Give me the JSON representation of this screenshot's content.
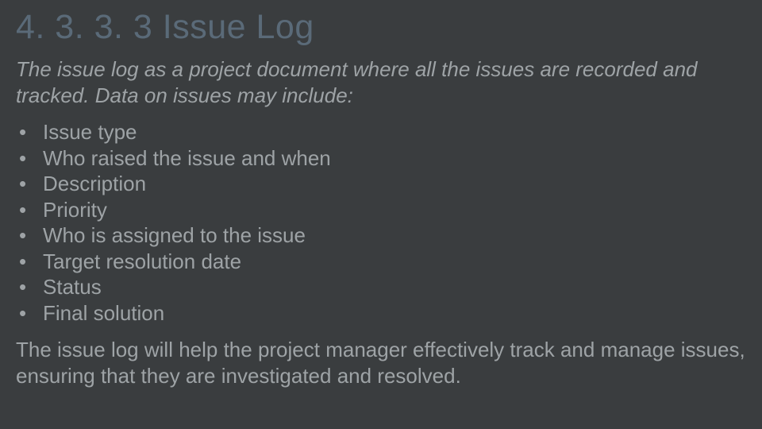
{
  "title": "4. 3. 3. 3 Issue Log",
  "intro": "The issue log as a project document where all the issues are recorded and tracked. Data on issues may include:",
  "bullets": [
    "Issue type",
    "Who raised the issue and when",
    "Description",
    "Priority",
    "Who is assigned to the issue",
    "Target resolution date",
    "Status",
    "Final solution"
  ],
  "conclusion": "The issue log will help the project manager effectively track and manage issues, ensuring that they are investigated and resolved."
}
